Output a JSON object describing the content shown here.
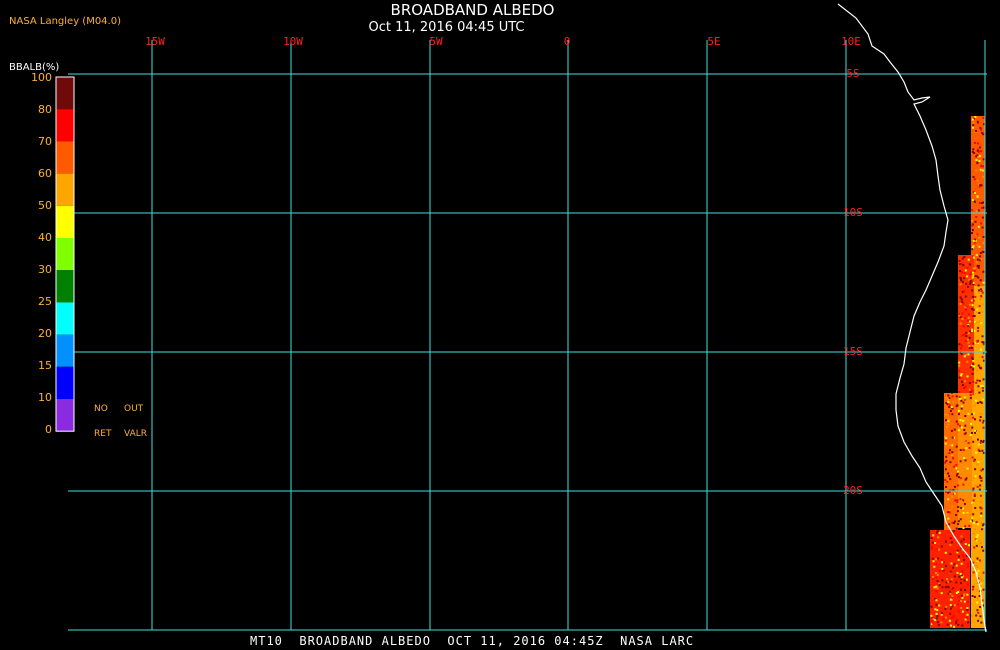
{
  "header": {
    "credit": "NASA Langley (M04.0)",
    "title": "BROADBAND ALBEDO",
    "timestamp": "Oct 11, 2016 04:45 UTC"
  },
  "footer": {
    "caption": "MT10  BROADBAND ALBEDO  OCT 11, 2016 04:45Z  NASA LARC"
  },
  "colorbar": {
    "label": "BBALB(%)",
    "ticks": [
      "100",
      "80",
      "70",
      "60",
      "50",
      "40",
      "30",
      "25",
      "20",
      "15",
      "10",
      "0"
    ],
    "colors": [
      "#6e0a0a",
      "#ff0000",
      "#ff5a00",
      "#ffa500",
      "#ffff00",
      "#80ff00",
      "#008000",
      "#00ffff",
      "#0090ff",
      "#0000ff",
      "#8a2be2"
    ],
    "no_retrieval": [
      "NO",
      "RET"
    ],
    "out_of_range": [
      "OUT",
      "VALR"
    ]
  },
  "map": {
    "background": "#000000",
    "grid_color": "#40e0e0",
    "lon_label_color": "#ff2020",
    "lat_label_color": "#ff2020",
    "coast_color": "#ffffff",
    "lon_labels": [
      "15W",
      "10W",
      "5W",
      "0",
      "5E",
      "10E"
    ],
    "lat_labels": [
      "5S",
      "10S",
      "15S",
      "20S"
    ]
  }
}
